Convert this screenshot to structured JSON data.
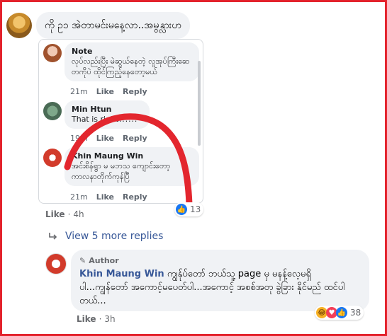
{
  "top_comment": {
    "text": "ကို ဥ၁ အဲတာမင်းမနေ့လာ..အမွန္လားဟ"
  },
  "screenshot": {
    "comments": [
      {
        "name": "Note",
        "text": "လုပ်လည်းပြီး မဲဆွယ်နေတဲ့ လူအုပ်ကြီးဆေ တကိုပဲ ထိုင်ကြည့်နေတော့မယ်",
        "time": "21m",
        "like": "Like",
        "reply": "Reply"
      },
      {
        "name": "Min Htun",
        "text": "That is right!!!!!!",
        "time": "19m",
        "like": "Like",
        "reply": "Reply"
      },
      {
        "name": "Khin Maung Win",
        "text": "အင်းစိန်ရွာ မ မဘသ ကျောင်းတော့ ကာလနာတိုက်ကုန်ပြီ",
        "time": "21m",
        "like": "Like",
        "reply": "Reply"
      }
    ]
  },
  "top_meta": {
    "like": "Like",
    "time": "4h",
    "reaction_count": "13"
  },
  "view_more": {
    "label": "View 5 more replies"
  },
  "reply": {
    "author_badge": "Author",
    "name": "Khin Maung Win",
    "text": "ကျွန်ုပ်တော် ဘယ်သူ့ page မှ မနန့်လေ့မရှိ ပါ...ကျွန်တော် အကောင့်မပေတ်ပါ...အကောင့် အစစ်အတု ခွဲခြား နိုင်မည် ထင်ပါတယ်...",
    "like": "Like",
    "time": "3h",
    "reaction_count": "38"
  },
  "colors": {
    "frame": "#e3222c",
    "link": "#385898",
    "bubble": "#f0f2f5",
    "meta": "#65676b"
  }
}
